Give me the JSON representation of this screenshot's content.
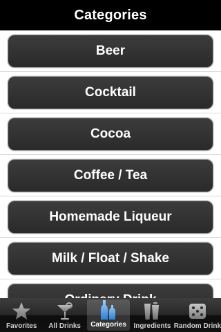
{
  "navbar": {
    "title": "Categories"
  },
  "categories": [
    {
      "label": "Beer"
    },
    {
      "label": "Cocktail"
    },
    {
      "label": "Cocoa"
    },
    {
      "label": "Coffee / Tea"
    },
    {
      "label": "Homemade Liqueur"
    },
    {
      "label": "Milk / Float / Shake"
    },
    {
      "label": "Ordinary Drink"
    }
  ],
  "tabbar": {
    "selected_index": 2,
    "items": [
      {
        "label": "Favorites",
        "icon": "star-icon"
      },
      {
        "label": "All Drinks",
        "icon": "cocktail-glass-icon"
      },
      {
        "label": "Categories",
        "icon": "bottles-icon"
      },
      {
        "label": "Ingredients",
        "icon": "shaker-icon"
      },
      {
        "label": "Random Drink",
        "icon": "dice-icon"
      }
    ]
  },
  "colors": {
    "navbar_bg": "#000000",
    "button_bg": "#333333",
    "accent_selected": "#4a90e2"
  }
}
